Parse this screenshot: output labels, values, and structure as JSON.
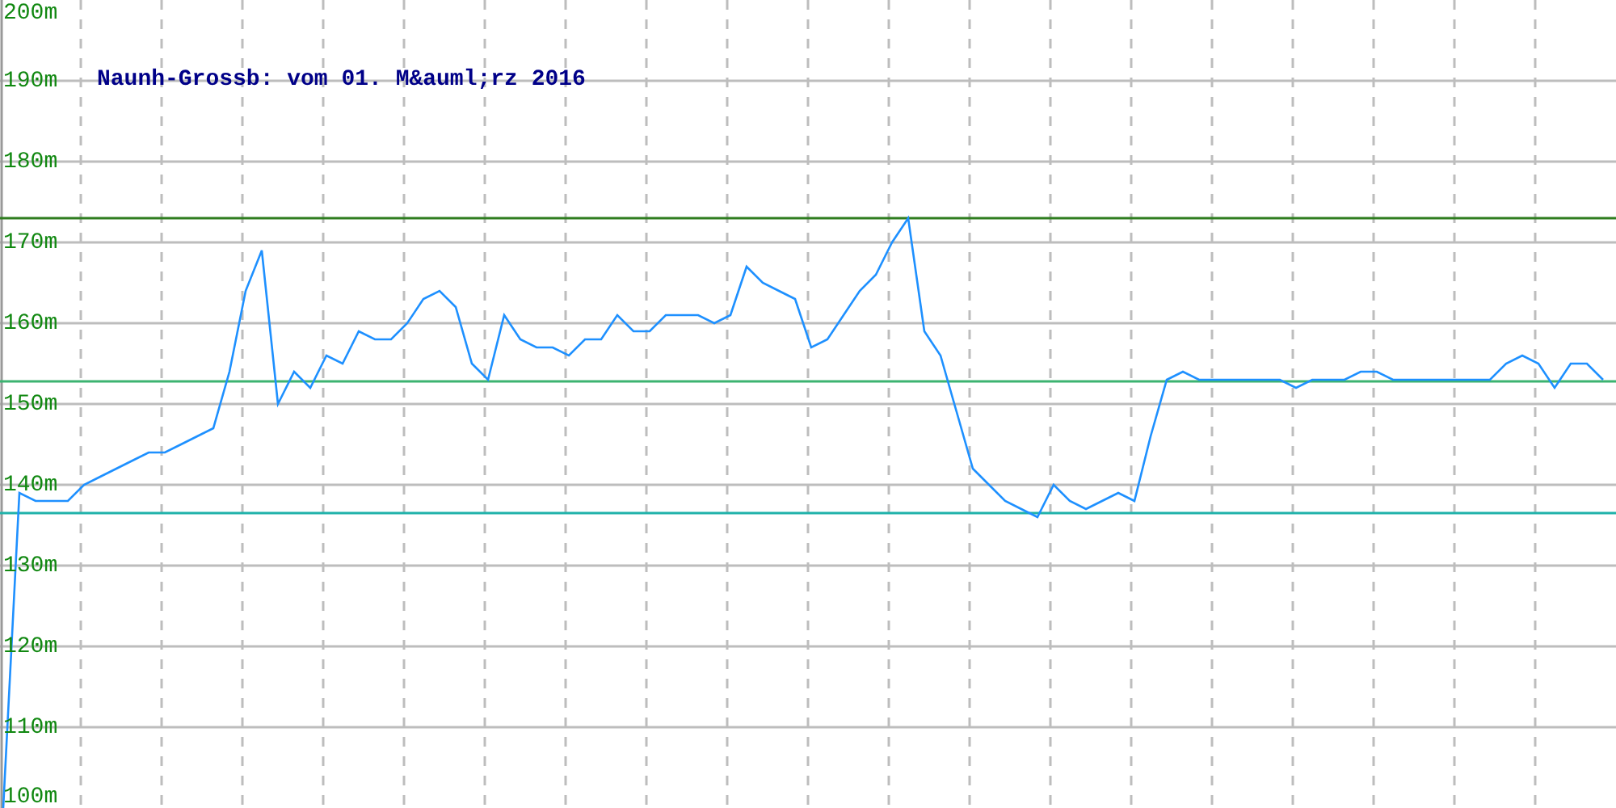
{
  "chart_data": {
    "type": "line",
    "title": "Naunh-Grossb: vom 01. M&auml;rz 2016",
    "categories": [
      null,
      null,
      null,
      null,
      null,
      null,
      null,
      null,
      null,
      null,
      null,
      null,
      null,
      null,
      null,
      null,
      null,
      null,
      null,
      null,
      null,
      null,
      null,
      null,
      null,
      null,
      null,
      null,
      null,
      null,
      null,
      null,
      null,
      null,
      null,
      null,
      null,
      null,
      null,
      null,
      null,
      null,
      null,
      null,
      null,
      null,
      null,
      null,
      null,
      null,
      null,
      null,
      null,
      null,
      null,
      null,
      null,
      null,
      null,
      null,
      null,
      null,
      null,
      null,
      null,
      null,
      null,
      null,
      null,
      null,
      null,
      null,
      null,
      null,
      null,
      null,
      null,
      null,
      null,
      null,
      null,
      null,
      null,
      null,
      null,
      null,
      null,
      null,
      null,
      null,
      null,
      null,
      null,
      null,
      null,
      null,
      null,
      null,
      null,
      null
    ],
    "series": [
      {
        "color": "#1e90ff",
        "values": [
          100,
          139,
          138,
          138,
          138,
          140,
          141,
          142,
          143,
          144,
          144,
          145,
          146,
          147,
          154,
          164,
          169,
          150,
          154,
          152,
          156,
          155,
          159,
          158,
          158,
          160,
          163,
          164,
          162,
          155,
          153,
          161,
          158,
          157,
          157,
          156,
          158,
          158,
          161,
          159,
          159,
          161,
          161,
          161,
          160,
          161,
          167,
          165,
          164,
          163,
          157,
          158,
          161,
          164,
          166,
          170,
          173,
          159,
          156,
          149,
          142,
          140,
          138,
          137,
          136,
          140,
          138,
          137,
          138,
          139,
          138,
          146,
          153,
          154,
          153,
          153,
          153,
          153,
          153,
          153,
          152,
          153,
          153,
          153,
          154,
          154,
          153,
          153,
          153,
          153,
          153,
          153,
          153,
          155,
          156,
          155,
          152,
          155,
          155,
          153
        ]
      }
    ],
    "ylim": [
      100,
      200
    ],
    "yticks": [
      {
        "value": 100,
        "label": "100m"
      },
      {
        "value": 110,
        "label": "110m"
      },
      {
        "value": 120,
        "label": "120m"
      },
      {
        "value": 130,
        "label": "130m"
      },
      {
        "value": 140,
        "label": "140m"
      },
      {
        "value": 150,
        "label": "150m"
      },
      {
        "value": 160,
        "label": "160m"
      },
      {
        "value": 170,
        "label": "170m"
      },
      {
        "value": 180,
        "label": "180m"
      },
      {
        "value": 190,
        "label": "190m"
      },
      {
        "value": 200,
        "label": "200m"
      }
    ],
    "grid": true,
    "ref_lines": [
      {
        "axis": "y",
        "value": 173,
        "color": "#2e7d1f"
      },
      {
        "axis": "y",
        "value": 152.8,
        "color": "#3cb371"
      },
      {
        "axis": "y",
        "value": 136.5,
        "color": "#20b2aa"
      }
    ]
  }
}
